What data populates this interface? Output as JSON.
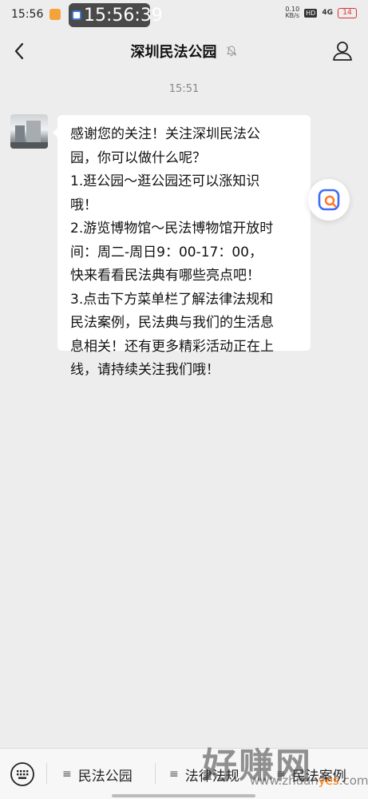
{
  "status_bar": {
    "time": "15:56",
    "overlay_clock": "15:56:39",
    "net_speed_value": "0.10",
    "net_speed_unit": "KB/s",
    "hd": "HD",
    "signal": "4G",
    "battery": "14"
  },
  "header": {
    "title": "深圳民法公园"
  },
  "chat": {
    "timestamp": "15:51",
    "message_lines": [
      "感谢您的关注！关注深圳民法公",
      "园，你可以做什么呢？",
      "1.逛公园～逛公园还可以涨知识",
      "哦！",
      "2.游览博物馆～民法博物馆开放时",
      "间：周二-周日9：00-17：00，",
      "快来看看民法典有哪些亮点吧！",
      "3.点击下方菜单栏了解法律法规和",
      "民法案例，民法典与我们的生活息",
      "息相关！还有更多精彩活动正在上",
      "线，请持续关注我们哦！"
    ]
  },
  "menu": {
    "items": [
      {
        "label": "民法公园"
      },
      {
        "label": "法律法规"
      },
      {
        "label": "民法案例"
      }
    ]
  },
  "watermark": {
    "big": "好赚网",
    "url_prefix": "www.zhuan",
    "url_accent": "yes",
    ".com": ".com"
  },
  "icons": {
    "back": "chevron-left-icon",
    "mute": "bell-off-icon",
    "profile": "person-icon",
    "search": "search-icon",
    "keyboard": "keyboard-icon",
    "menu": "menu-lines-icon"
  },
  "colors": {
    "background": "#ededed",
    "bubble": "#ffffff",
    "search_blue": "#3d6ef5",
    "search_orange": "#ff7a2f"
  }
}
